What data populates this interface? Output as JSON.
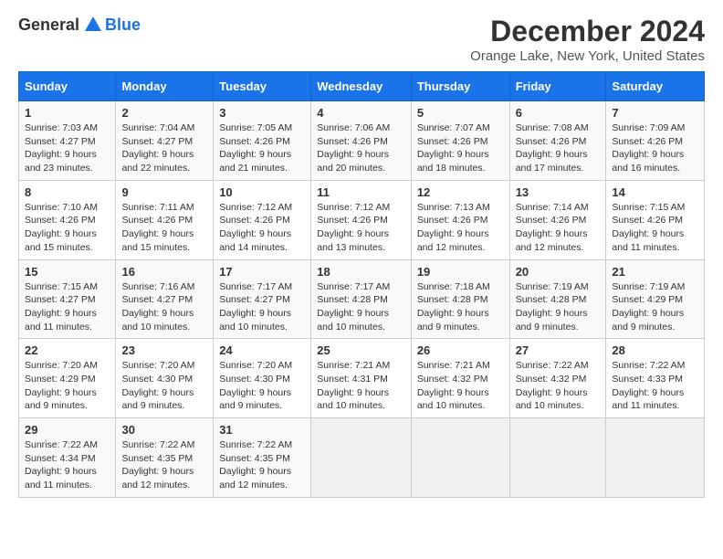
{
  "logo": {
    "general": "General",
    "blue": "Blue"
  },
  "header": {
    "month_title": "December 2024",
    "subtitle": "Orange Lake, New York, United States"
  },
  "weekdays": [
    "Sunday",
    "Monday",
    "Tuesday",
    "Wednesday",
    "Thursday",
    "Friday",
    "Saturday"
  ],
  "weeks": [
    [
      {
        "day": "1",
        "sunrise": "Sunrise: 7:03 AM",
        "sunset": "Sunset: 4:27 PM",
        "daylight": "Daylight: 9 hours and 23 minutes."
      },
      {
        "day": "2",
        "sunrise": "Sunrise: 7:04 AM",
        "sunset": "Sunset: 4:27 PM",
        "daylight": "Daylight: 9 hours and 22 minutes."
      },
      {
        "day": "3",
        "sunrise": "Sunrise: 7:05 AM",
        "sunset": "Sunset: 4:26 PM",
        "daylight": "Daylight: 9 hours and 21 minutes."
      },
      {
        "day": "4",
        "sunrise": "Sunrise: 7:06 AM",
        "sunset": "Sunset: 4:26 PM",
        "daylight": "Daylight: 9 hours and 20 minutes."
      },
      {
        "day": "5",
        "sunrise": "Sunrise: 7:07 AM",
        "sunset": "Sunset: 4:26 PM",
        "daylight": "Daylight: 9 hours and 18 minutes."
      },
      {
        "day": "6",
        "sunrise": "Sunrise: 7:08 AM",
        "sunset": "Sunset: 4:26 PM",
        "daylight": "Daylight: 9 hours and 17 minutes."
      },
      {
        "day": "7",
        "sunrise": "Sunrise: 7:09 AM",
        "sunset": "Sunset: 4:26 PM",
        "daylight": "Daylight: 9 hours and 16 minutes."
      }
    ],
    [
      {
        "day": "8",
        "sunrise": "Sunrise: 7:10 AM",
        "sunset": "Sunset: 4:26 PM",
        "daylight": "Daylight: 9 hours and 15 minutes."
      },
      {
        "day": "9",
        "sunrise": "Sunrise: 7:11 AM",
        "sunset": "Sunset: 4:26 PM",
        "daylight": "Daylight: 9 hours and 15 minutes."
      },
      {
        "day": "10",
        "sunrise": "Sunrise: 7:12 AM",
        "sunset": "Sunset: 4:26 PM",
        "daylight": "Daylight: 9 hours and 14 minutes."
      },
      {
        "day": "11",
        "sunrise": "Sunrise: 7:12 AM",
        "sunset": "Sunset: 4:26 PM",
        "daylight": "Daylight: 9 hours and 13 minutes."
      },
      {
        "day": "12",
        "sunrise": "Sunrise: 7:13 AM",
        "sunset": "Sunset: 4:26 PM",
        "daylight": "Daylight: 9 hours and 12 minutes."
      },
      {
        "day": "13",
        "sunrise": "Sunrise: 7:14 AM",
        "sunset": "Sunset: 4:26 PM",
        "daylight": "Daylight: 9 hours and 12 minutes."
      },
      {
        "day": "14",
        "sunrise": "Sunrise: 7:15 AM",
        "sunset": "Sunset: 4:26 PM",
        "daylight": "Daylight: 9 hours and 11 minutes."
      }
    ],
    [
      {
        "day": "15",
        "sunrise": "Sunrise: 7:15 AM",
        "sunset": "Sunset: 4:27 PM",
        "daylight": "Daylight: 9 hours and 11 minutes."
      },
      {
        "day": "16",
        "sunrise": "Sunrise: 7:16 AM",
        "sunset": "Sunset: 4:27 PM",
        "daylight": "Daylight: 9 hours and 10 minutes."
      },
      {
        "day": "17",
        "sunrise": "Sunrise: 7:17 AM",
        "sunset": "Sunset: 4:27 PM",
        "daylight": "Daylight: 9 hours and 10 minutes."
      },
      {
        "day": "18",
        "sunrise": "Sunrise: 7:17 AM",
        "sunset": "Sunset: 4:28 PM",
        "daylight": "Daylight: 9 hours and 10 minutes."
      },
      {
        "day": "19",
        "sunrise": "Sunrise: 7:18 AM",
        "sunset": "Sunset: 4:28 PM",
        "daylight": "Daylight: 9 hours and 9 minutes."
      },
      {
        "day": "20",
        "sunrise": "Sunrise: 7:19 AM",
        "sunset": "Sunset: 4:28 PM",
        "daylight": "Daylight: 9 hours and 9 minutes."
      },
      {
        "day": "21",
        "sunrise": "Sunrise: 7:19 AM",
        "sunset": "Sunset: 4:29 PM",
        "daylight": "Daylight: 9 hours and 9 minutes."
      }
    ],
    [
      {
        "day": "22",
        "sunrise": "Sunrise: 7:20 AM",
        "sunset": "Sunset: 4:29 PM",
        "daylight": "Daylight: 9 hours and 9 minutes."
      },
      {
        "day": "23",
        "sunrise": "Sunrise: 7:20 AM",
        "sunset": "Sunset: 4:30 PM",
        "daylight": "Daylight: 9 hours and 9 minutes."
      },
      {
        "day": "24",
        "sunrise": "Sunrise: 7:20 AM",
        "sunset": "Sunset: 4:30 PM",
        "daylight": "Daylight: 9 hours and 9 minutes."
      },
      {
        "day": "25",
        "sunrise": "Sunrise: 7:21 AM",
        "sunset": "Sunset: 4:31 PM",
        "daylight": "Daylight: 9 hours and 10 minutes."
      },
      {
        "day": "26",
        "sunrise": "Sunrise: 7:21 AM",
        "sunset": "Sunset: 4:32 PM",
        "daylight": "Daylight: 9 hours and 10 minutes."
      },
      {
        "day": "27",
        "sunrise": "Sunrise: 7:22 AM",
        "sunset": "Sunset: 4:32 PM",
        "daylight": "Daylight: 9 hours and 10 minutes."
      },
      {
        "day": "28",
        "sunrise": "Sunrise: 7:22 AM",
        "sunset": "Sunset: 4:33 PM",
        "daylight": "Daylight: 9 hours and 11 minutes."
      }
    ],
    [
      {
        "day": "29",
        "sunrise": "Sunrise: 7:22 AM",
        "sunset": "Sunset: 4:34 PM",
        "daylight": "Daylight: 9 hours and 11 minutes."
      },
      {
        "day": "30",
        "sunrise": "Sunrise: 7:22 AM",
        "sunset": "Sunset: 4:35 PM",
        "daylight": "Daylight: 9 hours and 12 minutes."
      },
      {
        "day": "31",
        "sunrise": "Sunrise: 7:22 AM",
        "sunset": "Sunset: 4:35 PM",
        "daylight": "Daylight: 9 hours and 12 minutes."
      },
      null,
      null,
      null,
      null
    ]
  ]
}
